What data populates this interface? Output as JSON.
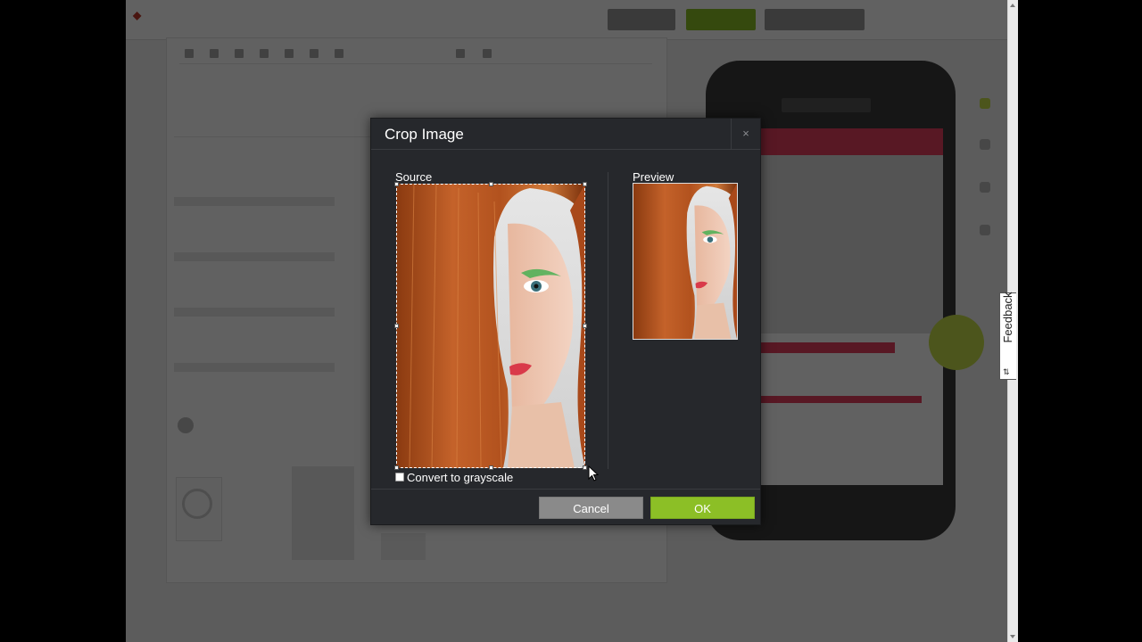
{
  "dialog": {
    "title": "Crop Image",
    "close_glyph": "×",
    "source_label": "Source",
    "preview_label": "Preview",
    "grayscale_label": "Convert to grayscale",
    "grayscale_checked": false,
    "cancel_label": "Cancel",
    "ok_label": "OK"
  },
  "feedback_tab": {
    "label": "Feedback",
    "icon": "sliders-icon"
  },
  "colors": {
    "dialog_bg": "#26282c",
    "ok_green": "#8cbf26",
    "cancel_gray": "#8a8a8a",
    "overlay": "rgba(0,0,0,0.62)"
  }
}
